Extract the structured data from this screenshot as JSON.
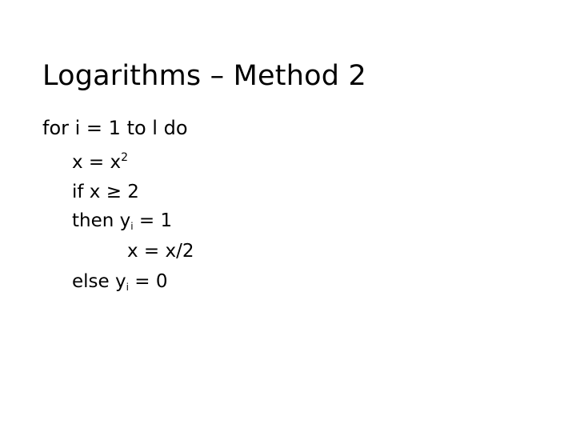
{
  "slide": {
    "title": "Logarithms – Method 2",
    "lines": [
      {
        "text": "for i = 1 to l do"
      },
      {
        "pre": "x = x",
        "sup": "2",
        "post": ""
      },
      {
        "text": "if x ≥ 2"
      },
      {
        "pre": "then y",
        "sub": "i",
        "post": " = 1"
      },
      {
        "text": "x = x/2"
      },
      {
        "pre": "else y",
        "sub": "i",
        "post": " = 0"
      }
    ]
  }
}
